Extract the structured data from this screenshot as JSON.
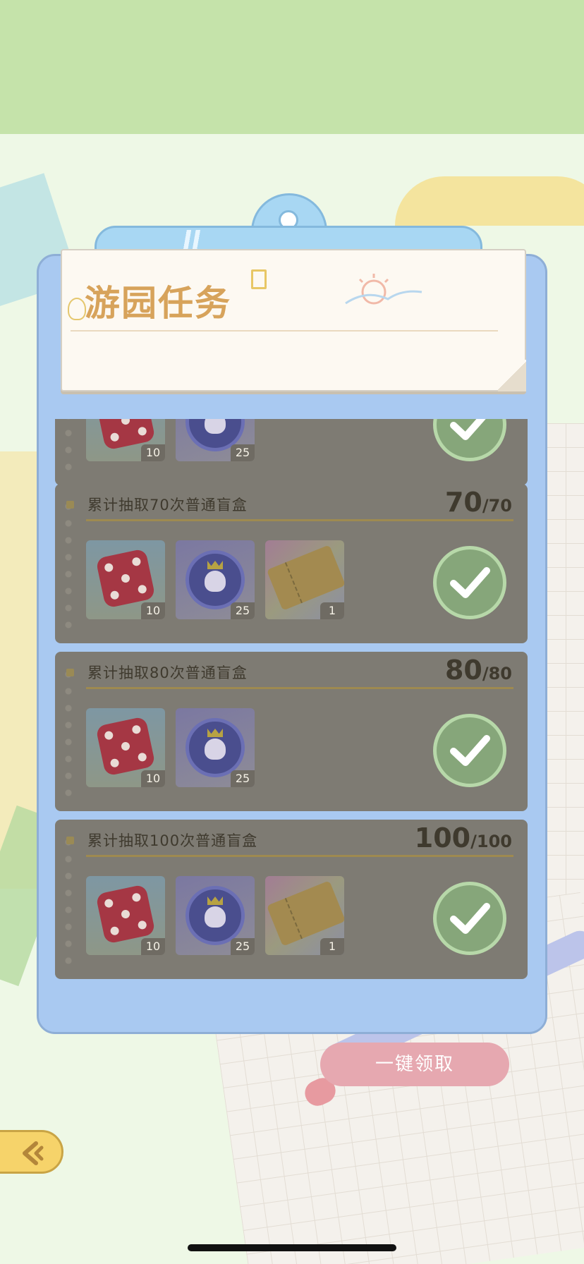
{
  "header": {
    "title": "游园任务"
  },
  "tasks": [
    {
      "name": "",
      "current": "",
      "total": "",
      "rewards": [
        {
          "type": "dice",
          "count": "10"
        },
        {
          "type": "coin",
          "count": "25"
        }
      ],
      "completed": true
    },
    {
      "name": "累计抽取70次普通盲盒",
      "current": "70",
      "total": "/70",
      "rewards": [
        {
          "type": "dice",
          "count": "10"
        },
        {
          "type": "coin",
          "count": "25"
        },
        {
          "type": "ticket",
          "count": "1"
        }
      ],
      "completed": true
    },
    {
      "name": "累计抽取80次普通盲盒",
      "current": "80",
      "total": "/80",
      "rewards": [
        {
          "type": "dice",
          "count": "10"
        },
        {
          "type": "coin",
          "count": "25"
        }
      ],
      "completed": true
    },
    {
      "name": "累计抽取100次普通盲盒",
      "current": "100",
      "total": "/100",
      "rewards": [
        {
          "type": "dice",
          "count": "10"
        },
        {
          "type": "coin",
          "count": "25"
        },
        {
          "type": "ticket",
          "count": "1"
        }
      ],
      "completed": true
    }
  ],
  "actions": {
    "claim_all_label": "一键领取"
  },
  "icons": {
    "check": "check-circle-icon",
    "back": "back-arrow-icon",
    "dice": "dice-icon",
    "coin": "penguin-coin-icon",
    "ticket": "ticket-icon"
  },
  "colors": {
    "top_band": "#c5e3aa",
    "clipboard": "#a9c9f1",
    "title": "#d7a35b",
    "claim_button": "#e6a8b0",
    "back_button": "#f6d36a"
  }
}
